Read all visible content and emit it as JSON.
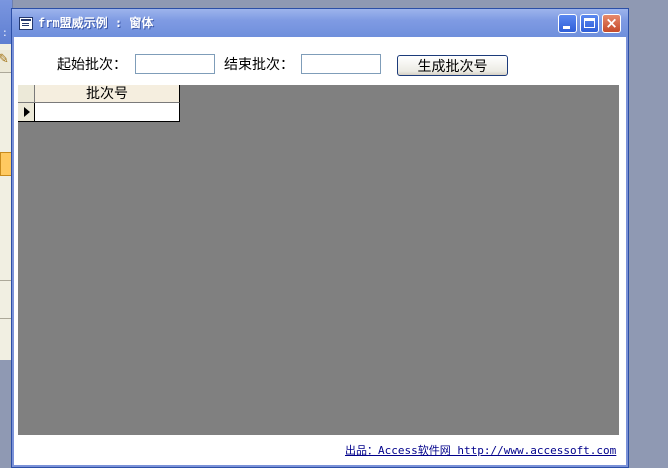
{
  "window": {
    "title": "frm盟威示例 : 窗体"
  },
  "form": {
    "start_label": "起始批次：",
    "start_value": "",
    "end_label": "结束批次：",
    "end_value": "",
    "generate_button": "生成批次号"
  },
  "datasheet": {
    "columns": [
      "批次号"
    ],
    "rows": [
      [
        ""
      ]
    ]
  },
  "footer": {
    "credit": "出品：Access软件网 http://www.accessoft.com"
  },
  "colors": {
    "titlebar": "#7f9be3",
    "datasheet_bg": "#808080",
    "desktop": "#8f99b3"
  },
  "icons": [
    "form-icon",
    "minimize-icon",
    "maximize-icon",
    "close-icon",
    "record-pointer-icon"
  ]
}
